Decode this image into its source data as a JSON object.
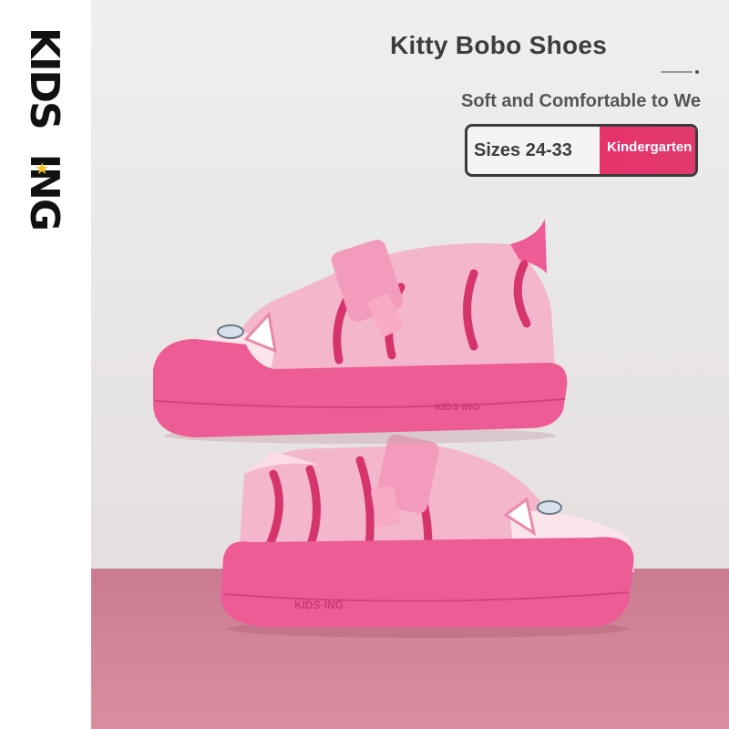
{
  "brand": {
    "logo_text": "KIDS·ING",
    "logo_top": "KIDS",
    "logo_bottom": "ING"
  },
  "product": {
    "title": "Kitty Bobo Shoes",
    "tagline": "Soft and Comfortable to We",
    "size_range": "Sizes 24-33",
    "category_tag": "Kindergarten",
    "sole_imprint": "KIDS·ING"
  },
  "colors": {
    "shoe_pink": "#f4b6cc",
    "sole_pink": "#ee5c96",
    "stripe_magenta": "#d6346f",
    "tag_pink": "#e6336b",
    "floor_pink": "#d18397",
    "logo_star": "#f2c019"
  },
  "icons": {
    "logo_star": "star-icon"
  }
}
